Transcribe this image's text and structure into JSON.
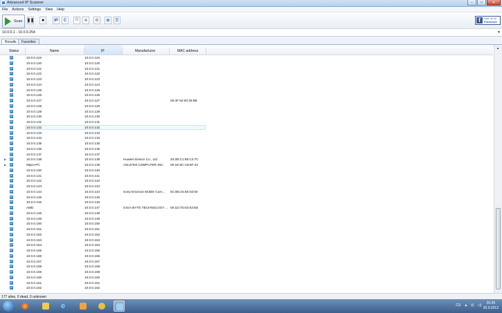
{
  "window": {
    "title": "Advanced IP Scanner"
  },
  "menu": [
    "File",
    "Actions",
    "Settings",
    "View",
    "Help"
  ],
  "toolbar": {
    "scan_label": "Scan",
    "ip_label": "IP",
    "c_label": "C",
    "facebook": {
      "line1": "Like us on",
      "line2": "Facebook"
    }
  },
  "range": {
    "value": "10.0.0.1 - 10.0.0.254"
  },
  "tabs": [
    "Results",
    "Favorites"
  ],
  "columns": {
    "status": "Status",
    "name": "Name",
    "ip": "IP",
    "manufacturer": "Manufacturer",
    "mac": "MAC address"
  },
  "rows": [
    {
      "name": "10.0.0.119",
      "ip": "10.0.0.119",
      "manufacturer": "",
      "mac": "",
      "expand": false
    },
    {
      "name": "10.0.0.120",
      "ip": "10.0.0.120",
      "manufacturer": "",
      "mac": "",
      "expand": false
    },
    {
      "name": "10.0.0.121",
      "ip": "10.0.0.121",
      "manufacturer": "",
      "mac": "",
      "expand": false
    },
    {
      "name": "10.0.0.122",
      "ip": "10.0.0.122",
      "manufacturer": "",
      "mac": "",
      "expand": false
    },
    {
      "name": "10.0.0.123",
      "ip": "10.0.0.123",
      "manufacturer": "",
      "mac": "",
      "expand": false
    },
    {
      "name": "10.0.0.124",
      "ip": "10.0.0.124",
      "manufacturer": "",
      "mac": "",
      "expand": false
    },
    {
      "name": "10.0.0.125",
      "ip": "10.0.0.125",
      "manufacturer": "",
      "mac": "",
      "expand": false
    },
    {
      "name": "10.0.0.126",
      "ip": "10.0.0.126",
      "manufacturer": "",
      "mac": "",
      "expand": false
    },
    {
      "name": "10.0.0.127",
      "ip": "10.0.0.127",
      "manufacturer": "",
      "mac": "00:4F:62:00:29:8B",
      "expand": false
    },
    {
      "name": "10.0.0.128",
      "ip": "10.0.0.128",
      "manufacturer": "",
      "mac": "",
      "expand": false
    },
    {
      "name": "10.0.0.129",
      "ip": "10.0.0.129",
      "manufacturer": "",
      "mac": "",
      "expand": false
    },
    {
      "name": "10.0.0.130",
      "ip": "10.0.0.130",
      "manufacturer": "",
      "mac": "",
      "expand": false
    },
    {
      "name": "10.0.0.131",
      "ip": "10.0.0.131",
      "manufacturer": "",
      "mac": "",
      "expand": false
    },
    {
      "name": "10.0.0.132",
      "ip": "10.0.0.132",
      "manufacturer": "",
      "mac": "",
      "expand": false,
      "selected": true
    },
    {
      "name": "10.0.0.133",
      "ip": "10.0.0.133",
      "manufacturer": "",
      "mac": "",
      "expand": false
    },
    {
      "name": "10.0.0.134",
      "ip": "10.0.0.134",
      "manufacturer": "",
      "mac": "",
      "expand": false
    },
    {
      "name": "10.0.0.135",
      "ip": "10.0.0.135",
      "manufacturer": "",
      "mac": "",
      "expand": false
    },
    {
      "name": "10.0.0.136",
      "ip": "10.0.0.136",
      "manufacturer": "",
      "mac": "",
      "expand": false
    },
    {
      "name": "10.0.0.137",
      "ip": "10.0.0.137",
      "manufacturer": "",
      "mac": "",
      "expand": false
    },
    {
      "name": "10.0.0.138",
      "ip": "10.0.0.138",
      "manufacturer": "Huawei Device Co., Ltd",
      "mac": "20:2B:C1:95:C4:7C",
      "expand": true
    },
    {
      "name": "Mipro-PC",
      "ip": "10.0.0.139",
      "manufacturer": "ASUSTek COMPUTER INC.",
      "mac": "00:1E:8C:A8:6F:33",
      "expand": true
    },
    {
      "name": "10.0.0.140",
      "ip": "10.0.0.140",
      "manufacturer": "",
      "mac": "",
      "expand": false
    },
    {
      "name": "10.0.0.141",
      "ip": "10.0.0.141",
      "manufacturer": "",
      "mac": "",
      "expand": false
    },
    {
      "name": "10.0.0.142",
      "ip": "10.0.0.142",
      "manufacturer": "",
      "mac": "",
      "expand": false
    },
    {
      "name": "10.0.0.143",
      "ip": "10.0.0.143",
      "manufacturer": "",
      "mac": "",
      "expand": false
    },
    {
      "name": "10.0.0.144",
      "ip": "10.0.0.144",
      "manufacturer": "Sony Ericsson Mobile Com...",
      "mac": "5C:B5:24:5E:02:50",
      "expand": false
    },
    {
      "name": "10.0.0.145",
      "ip": "10.0.0.145",
      "manufacturer": "",
      "mac": "",
      "expand": false
    },
    {
      "name": "10.0.0.146",
      "ip": "10.0.0.146",
      "manufacturer": "",
      "mac": "",
      "expand": false
    },
    {
      "name": "AMD",
      "ip": "10.0.0.147",
      "manufacturer": "GIGA-BYTE TECHNOLOGY ...",
      "mac": "00:1D:7D:53:53:6D",
      "expand": false
    },
    {
      "name": "10.0.0.148",
      "ip": "10.0.0.148",
      "manufacturer": "",
      "mac": "",
      "expand": false
    },
    {
      "name": "10.0.0.149",
      "ip": "10.0.0.149",
      "manufacturer": "",
      "mac": "",
      "expand": false
    },
    {
      "name": "10.0.0.150",
      "ip": "10.0.0.150",
      "manufacturer": "",
      "mac": "",
      "expand": false
    },
    {
      "name": "10.0.0.151",
      "ip": "10.0.0.151",
      "manufacturer": "",
      "mac": "",
      "expand": false
    },
    {
      "name": "10.0.0.152",
      "ip": "10.0.0.152",
      "manufacturer": "",
      "mac": "",
      "expand": false
    },
    {
      "name": "10.0.0.153",
      "ip": "10.0.0.153",
      "manufacturer": "",
      "mac": "",
      "expand": false
    },
    {
      "name": "10.0.0.154",
      "ip": "10.0.0.154",
      "manufacturer": "",
      "mac": "",
      "expand": false
    },
    {
      "name": "10.0.0.155",
      "ip": "10.0.0.155",
      "manufacturer": "",
      "mac": "",
      "expand": false
    },
    {
      "name": "10.0.0.156",
      "ip": "10.0.0.156",
      "manufacturer": "",
      "mac": "",
      "expand": false
    },
    {
      "name": "10.0.0.157",
      "ip": "10.0.0.157",
      "manufacturer": "",
      "mac": "",
      "expand": false
    },
    {
      "name": "10.0.0.158",
      "ip": "10.0.0.158",
      "manufacturer": "",
      "mac": "",
      "expand": false
    },
    {
      "name": "10.0.0.159",
      "ip": "10.0.0.159",
      "manufacturer": "",
      "mac": "",
      "expand": false
    },
    {
      "name": "10.0.0.160",
      "ip": "10.0.0.160",
      "manufacturer": "",
      "mac": "",
      "expand": false
    },
    {
      "name": "10.0.0.161",
      "ip": "10.0.0.161",
      "manufacturer": "",
      "mac": "",
      "expand": false
    },
    {
      "name": "10.0.0.162",
      "ip": "10.0.0.162",
      "manufacturer": "",
      "mac": "",
      "expand": false
    }
  ],
  "statusbar": {
    "text": "177 alive, 0 dead, 0 unknown"
  },
  "taskbar": {
    "lang": "CS",
    "time": "20:35",
    "date": "30.9.2012"
  },
  "colors": {
    "scan_green": "#2e9a2c",
    "facebook_blue": "#3b5998",
    "taskbar": "#3c5f8c"
  }
}
